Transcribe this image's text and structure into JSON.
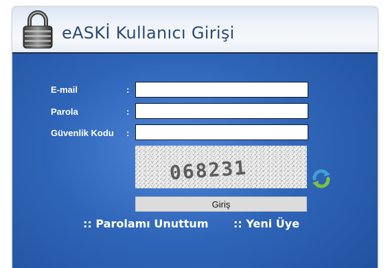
{
  "header": {
    "title": "eASKİ Kullanıcı Girişi",
    "icon": "padlock-icon"
  },
  "form": {
    "email_label": "E-mail",
    "password_label": "Parola",
    "security_label": "Güvenlik Kodu",
    "colon": ":",
    "email_value": "",
    "password_value": "",
    "security_value": "",
    "captcha_text": "068231",
    "refresh_icon": "refresh-icon",
    "submit_label": "Giriş"
  },
  "links": {
    "forgot_password": ":: Parolamı Unuttum",
    "new_member": ":: Yeni Üye"
  },
  "colors": {
    "panel_blue": "#2f65b8",
    "header_text": "#2b4a73",
    "label_text": "#ffffff"
  }
}
